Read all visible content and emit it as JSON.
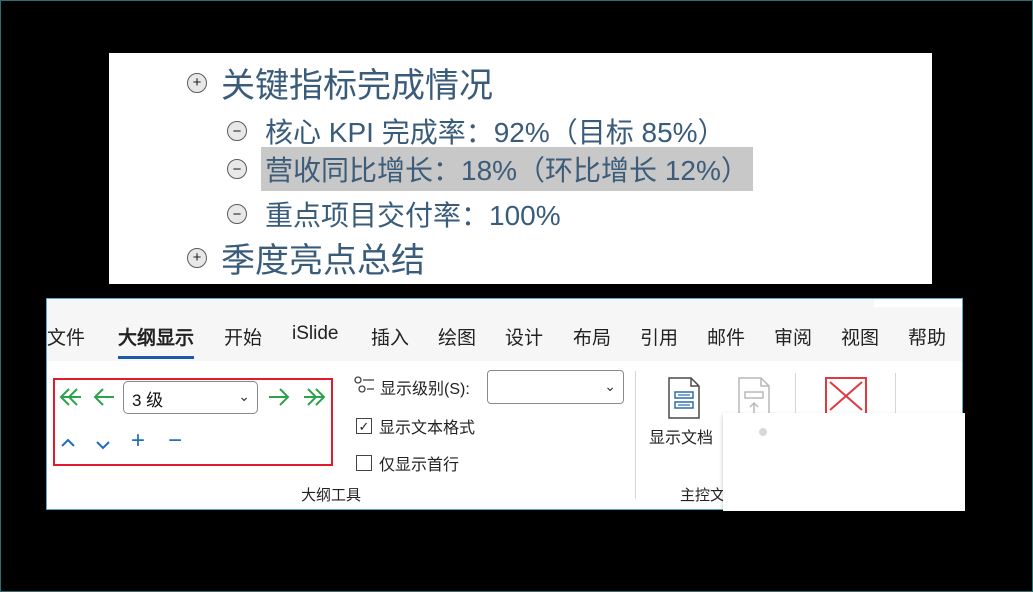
{
  "outline": {
    "items": [
      {
        "symbol": "+",
        "text": "关键指标完成情况",
        "level": 1
      },
      {
        "symbol": "−",
        "text": "核心 KPI 完成率：92%（目标 85%）",
        "level": 2
      },
      {
        "symbol": "−",
        "text": "营收同比增长：18%（环比增长 12%）",
        "level": 2,
        "selected": true
      },
      {
        "symbol": "−",
        "text": "重点项目交付率：100%",
        "level": 2
      },
      {
        "symbol": "+",
        "text": "季度亮点总结",
        "level": 1
      }
    ]
  },
  "ribbon": {
    "tabs": [
      "文件",
      "大纲显示",
      "开始",
      "iSlide",
      "插入",
      "绘图",
      "设计",
      "布局",
      "引用",
      "邮件",
      "审阅",
      "视图",
      "帮助"
    ],
    "active_tab": "大纲显示",
    "outline_tools": {
      "promote_to_heading1_icon": "double-left-arrow-icon",
      "promote_icon": "left-arrow-icon",
      "level_value": "3 级",
      "demote_icon": "right-arrow-icon",
      "demote_to_body_icon": "double-right-arrow-icon",
      "move_up_icon": "chevron-up-icon",
      "move_down_icon": "chevron-down-icon",
      "expand_label": "+",
      "collapse_label": "−",
      "show_level_label": "显示级别(S):",
      "show_level_value": "",
      "show_text_formatting_label": "显示文本格式",
      "show_text_formatting_checked": true,
      "show_first_line_only_label": "仅显示首行",
      "show_first_line_only_checked": false,
      "group_label": "大纲工具"
    },
    "master_document": {
      "show_document_label": "显示文档",
      "group_label": "主控文"
    },
    "close_icon": "close-outline-view-icon"
  },
  "colors": {
    "outline_text": "#3a5c7b",
    "selected_bg": "#c8c8c8",
    "arrow_green": "#2ca24c",
    "op_blue": "#1f6cc0",
    "highlight_red": "#e01c2c",
    "active_tab_underline": "#1e58a6"
  }
}
